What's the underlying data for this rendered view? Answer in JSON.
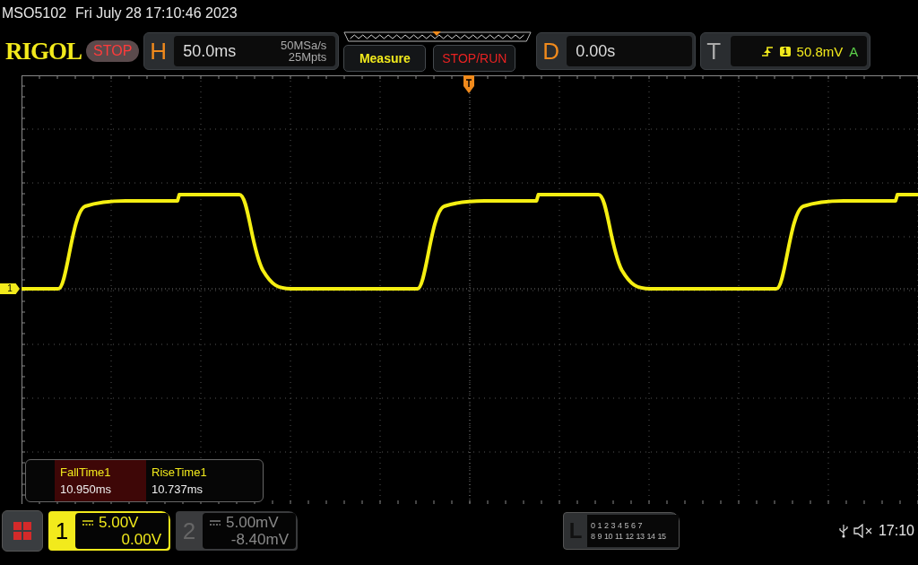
{
  "model": "MSO5102",
  "datetime": "Fri July 28 17:10:46 2023",
  "brand": "RIGOL",
  "run_state": "STOP",
  "horizontal": {
    "label": "H",
    "timebase": "50.0ms",
    "sample_rate": "50MSa/s",
    "memory_depth": "25Mpts"
  },
  "buttons": [
    {
      "label": "Measure",
      "kind": "measure"
    },
    {
      "label": "STOP/RUN",
      "kind": "run"
    }
  ],
  "delay": {
    "label": "D",
    "value": "0.00s"
  },
  "trigger": {
    "label": "T",
    "source": "1",
    "level": "50.8mV",
    "mode": "A"
  },
  "channel_marker": "1",
  "measurements": [
    {
      "name": "FallTime1",
      "value": "10.950ms",
      "selected": true
    },
    {
      "name": "RiseTime1",
      "value": "10.737ms",
      "selected": false
    }
  ],
  "channels": [
    {
      "number": "1",
      "scale": "5.00V",
      "offset": "0.00V",
      "selected": true
    },
    {
      "number": "2",
      "scale": "5.00mV",
      "offset": "-8.40mV",
      "selected": false
    }
  ],
  "logic": {
    "label": "L",
    "bits_row_1": [
      "0",
      "1",
      "2",
      "3",
      "4",
      "5",
      "6",
      "7"
    ],
    "bits_row_2": [
      "8",
      "9",
      "10",
      "11",
      "12",
      "13",
      "14",
      "15"
    ]
  },
  "clock": "17:10"
}
